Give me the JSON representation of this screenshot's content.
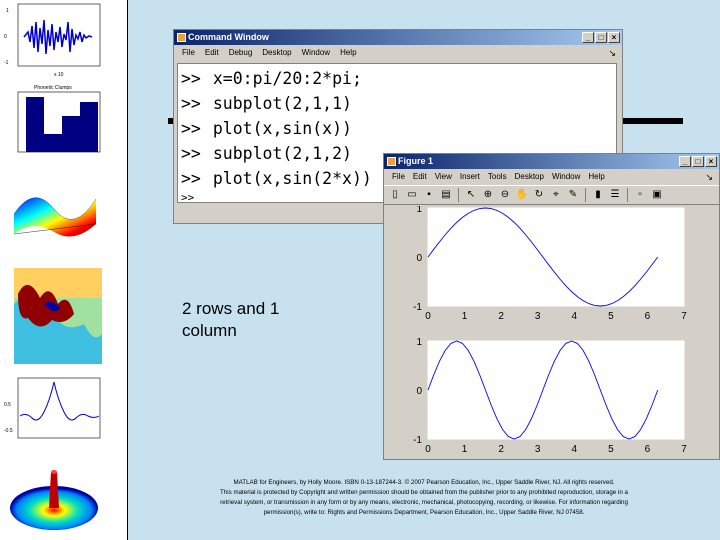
{
  "command_window": {
    "title": "Command Window",
    "menu": [
      "File",
      "Edit",
      "Debug",
      "Desktop",
      "Window",
      "Help"
    ],
    "dock_icon": "dock-arrow-icon",
    "prompt": ">>",
    "lines": [
      "x=0:pi/20:2*pi;",
      "subplot(2,1,1)",
      "plot(x,sin(x))",
      "subplot(2,1,2)",
      "plot(x,sin(2*x))"
    ],
    "partial_prompt": ">>"
  },
  "figure_window": {
    "title": "Figure 1",
    "menu": [
      "File",
      "Edit",
      "View",
      "Insert",
      "Tools",
      "Desktop",
      "Window",
      "Help"
    ],
    "toolbar_icons": [
      "new-icon",
      "open-icon",
      "save-icon",
      "print-icon",
      "arrow-icon",
      "zoom-in-icon",
      "zoom-out-icon",
      "pan-icon",
      "rotate-icon",
      "datacursor-icon",
      "brush-icon",
      "colorbar-icon",
      "legend-icon",
      "hide-tools-icon",
      "show-tools-icon"
    ]
  },
  "chart_data": [
    {
      "type": "line",
      "series": [
        {
          "function": "sin(x)",
          "x_start": 0,
          "x_end": 6.2832,
          "color": "#0000ff"
        }
      ],
      "xlim": [
        0,
        7
      ],
      "xticks": [
        "0",
        "1",
        "2",
        "3",
        "4",
        "5",
        "6",
        "7"
      ],
      "yticks": [
        "1",
        "0",
        "-1"
      ],
      "ylim": [
        -1,
        1
      ]
    },
    {
      "type": "line",
      "series": [
        {
          "function": "sin(2*x)",
          "x_start": 0,
          "x_end": 6.2832,
          "color": "#0000ff"
        }
      ],
      "xlim": [
        0,
        7
      ],
      "xticks": [
        "0",
        "1",
        "2",
        "3",
        "4",
        "5",
        "6",
        "7"
      ],
      "yticks": [
        "1",
        "0",
        "-1"
      ],
      "ylim": [
        -1,
        1
      ]
    }
  ],
  "callout": {
    "line1": "2 rows and 1",
    "line2": "column"
  },
  "footer": {
    "line1": "MATLAB for Engineers, by Holly Moore. ISBN 0-13-187244-3. © 2007 Pearson Education, Inc., Upper Saddle River, NJ. All rights reserved.",
    "line2": "This material is protected by Copyright and written permission should be obtained from the publisher prior to any prohibited reproduction, storage in a",
    "line3": "retrieval system, or transmission in any form or by any means, electronic, mechanical, photocopying, recording, or likewise. For information regarding",
    "line4": "permission(s), write to: Rights and Permissions Department, Pearson Education, Inc., Upper Saddle River, NJ 07458."
  },
  "thumbnails": [
    "audio-waveform-thumb",
    "bar-chart-thumb",
    "surface-plot-thumb",
    "fractal-image-thumb",
    "sinc-plot-thumb",
    "3d-surface-thumb"
  ],
  "colors": {
    "slide_bg": "#c8e1ee",
    "win_gray": "#d4d0c8",
    "title_blue": "#0a246a",
    "line_blue": "#0000ff"
  }
}
